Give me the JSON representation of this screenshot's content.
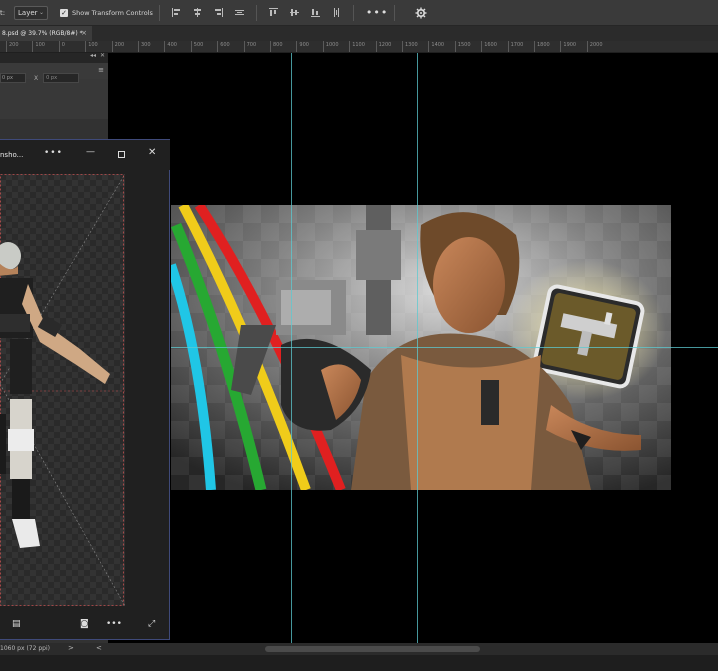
{
  "options_bar": {
    "auto_select_label": "t:",
    "auto_select_value": "Layer",
    "show_transform_checked": true,
    "show_transform_label": "Show Transform Controls",
    "more_label": "•••"
  },
  "document_tab": {
    "title": "8.psd @ 39.7% (RGB/8#) *",
    "close_label": "×"
  },
  "ruler": {
    "ticks": [
      "200",
      "100",
      "0",
      "100",
      "200",
      "300",
      "400",
      "500",
      "600",
      "700",
      "800",
      "900",
      "1000",
      "1100",
      "1200",
      "1300",
      "1400",
      "1500",
      "1600",
      "1700",
      "1800",
      "1900",
      "2000"
    ]
  },
  "left_panel": {
    "input_value": "0 px",
    "x_label": "X",
    "x_value": "0 px"
  },
  "floating_window": {
    "title": "nsho...",
    "more_label": "•••",
    "minimize_label": "—",
    "close_label": "✕",
    "bottom_more_label": "•••"
  },
  "status_bar": {
    "doc_info": "1060 px (72 ppi)",
    "arrow": ">",
    "scroll_left": "<"
  },
  "colors": {
    "guide": "#5ec9d0",
    "window_border": "#3f4a7a",
    "panel_bg": "#323232",
    "toolbar_bg": "#3a3a3a"
  }
}
